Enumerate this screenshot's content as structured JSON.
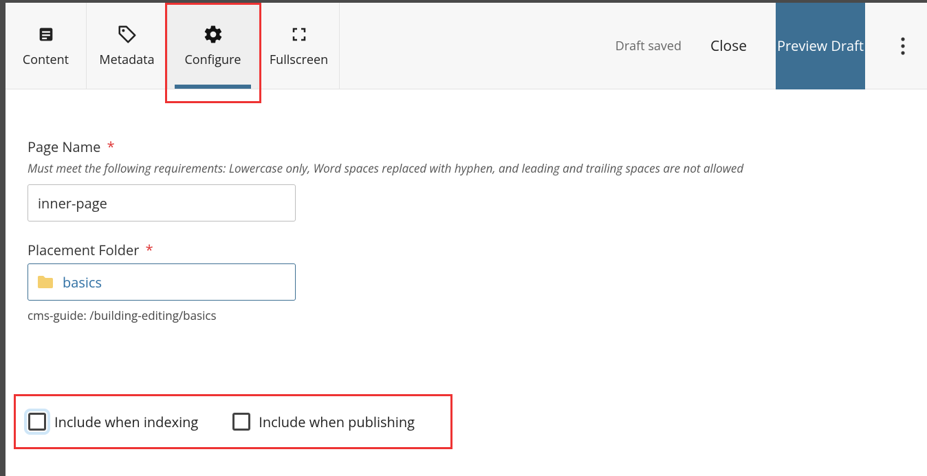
{
  "toolbar": {
    "tabs": [
      {
        "id": "content",
        "label": "Content"
      },
      {
        "id": "metadata",
        "label": "Metadata"
      },
      {
        "id": "configure",
        "label": "Configure"
      },
      {
        "id": "fullscreen",
        "label": "Fullscreen"
      }
    ],
    "active_tab": "configure",
    "status": "Draft saved",
    "close_label": "Close",
    "preview_label": "Preview Draft"
  },
  "form": {
    "page_name": {
      "label": "Page Name",
      "required_marker": "*",
      "help": "Must meet the following requirements: Lowercase only, Word spaces replaced with hyphen, and leading and trailing spaces are not allowed",
      "value": "inner-page"
    },
    "placement_folder": {
      "label": "Placement Folder",
      "required_marker": "*",
      "value": "basics",
      "path": "cms-guide: /building-editing/basics"
    },
    "include_indexing": {
      "label": "Include when indexing",
      "checked": false
    },
    "include_publishing": {
      "label": "Include when publishing",
      "checked": false
    }
  }
}
